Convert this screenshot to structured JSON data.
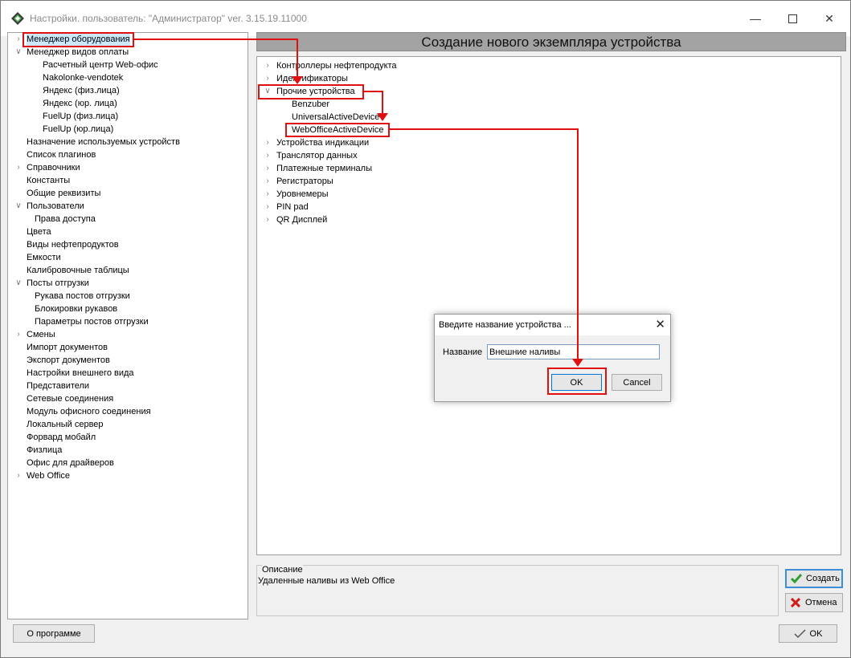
{
  "window": {
    "title": "Настройки. пользователь: \"Администратор\" ver. 3.15.19.11000"
  },
  "left_tree": [
    {
      "label": "Менеджер оборудования",
      "level": 0,
      "arrow": "right"
    },
    {
      "label": "Менеджер видов оплаты",
      "level": 0,
      "arrow": "down"
    },
    {
      "label": "Расчетный центр Web-офис",
      "level": 2
    },
    {
      "label": "Nakolonke-vendotek",
      "level": 2
    },
    {
      "label": "Яндекс (физ.лица)",
      "level": 2
    },
    {
      "label": "Яндекс (юр. лица)",
      "level": 2
    },
    {
      "label": "FuelUp (физ.лица)",
      "level": 2
    },
    {
      "label": "FuelUp (юр.лица)",
      "level": 2
    },
    {
      "label": "Назначение используемых устройств",
      "level": 0
    },
    {
      "label": "Список плагинов",
      "level": 0
    },
    {
      "label": "Справочники",
      "level": 0,
      "arrow": "right"
    },
    {
      "label": "Константы",
      "level": 0
    },
    {
      "label": "Общие реквизиты",
      "level": 0
    },
    {
      "label": "Пользователи",
      "level": 0,
      "arrow": "down"
    },
    {
      "label": "Права доступа",
      "level": 1
    },
    {
      "label": "Цвета",
      "level": 0
    },
    {
      "label": "Виды нефтепродуктов",
      "level": 0
    },
    {
      "label": "Емкости",
      "level": 0
    },
    {
      "label": "Калибровочные таблицы",
      "level": 0
    },
    {
      "label": "Посты отгрузки",
      "level": 0,
      "arrow": "down"
    },
    {
      "label": "Рукава постов отгрузки",
      "level": 1
    },
    {
      "label": "Блокировки рукавов",
      "level": 1
    },
    {
      "label": "Параметры постов отгрузки",
      "level": 1
    },
    {
      "label": "Смены",
      "level": 0,
      "arrow": "right"
    },
    {
      "label": "Импорт документов",
      "level": 0
    },
    {
      "label": "Экспорт документов",
      "level": 0
    },
    {
      "label": "Настройки внешнего вида",
      "level": 0
    },
    {
      "label": "Представители",
      "level": 0
    },
    {
      "label": "Сетевые соединения",
      "level": 0
    },
    {
      "label": "Модуль офисного соединения",
      "level": 0
    },
    {
      "label": "Локальный сервер",
      "level": 0
    },
    {
      "label": "Форвард мобайл",
      "level": 0
    },
    {
      "label": "Физлица",
      "level": 0
    },
    {
      "label": "Офис для драйверов",
      "level": 0
    },
    {
      "label": "Web Office",
      "level": 0,
      "arrow": "right"
    }
  ],
  "right_header": "Создание нового экземпляра устройства",
  "right_tree": [
    {
      "label": "Контроллеры нефтепродукта",
      "level": 0,
      "arrow": "right"
    },
    {
      "label": "Идентификаторы",
      "level": 0,
      "arrow": "right"
    },
    {
      "label": "Прочие устройства",
      "level": 0,
      "arrow": "down"
    },
    {
      "label": "Benzuber",
      "level": 1
    },
    {
      "label": "UniversalActiveDevice",
      "level": 1
    },
    {
      "label": "WebOfficeActiveDevice",
      "level": 1
    },
    {
      "label": "Устройства индикации",
      "level": 0,
      "arrow": "right"
    },
    {
      "label": "Транслятор данных",
      "level": 0,
      "arrow": "right"
    },
    {
      "label": "Платежные терминалы",
      "level": 0,
      "arrow": "right"
    },
    {
      "label": "Регистраторы",
      "level": 0,
      "arrow": "right"
    },
    {
      "label": "Уровнемеры",
      "level": 0,
      "arrow": "right"
    },
    {
      "label": "PIN pad",
      "level": 0,
      "arrow": "right"
    },
    {
      "label": "QR Дисплей",
      "level": 0,
      "arrow": "right"
    }
  ],
  "description": {
    "legend": "Описание",
    "text": "Удаленные наливы из Web Office"
  },
  "buttons": {
    "create": "Создать",
    "cancel": "Отмена",
    "about": "О программе",
    "ok": "OK"
  },
  "dialog": {
    "title": "Введите название устройства ...",
    "label": "Название",
    "value": "Внешние наливы",
    "ok": "OK",
    "cancel": "Cancel"
  },
  "colors": {
    "highlight": "#e01010",
    "header_bg": "#a3a3a3",
    "check": "#2e9e2e",
    "cross": "#d11a1a"
  }
}
